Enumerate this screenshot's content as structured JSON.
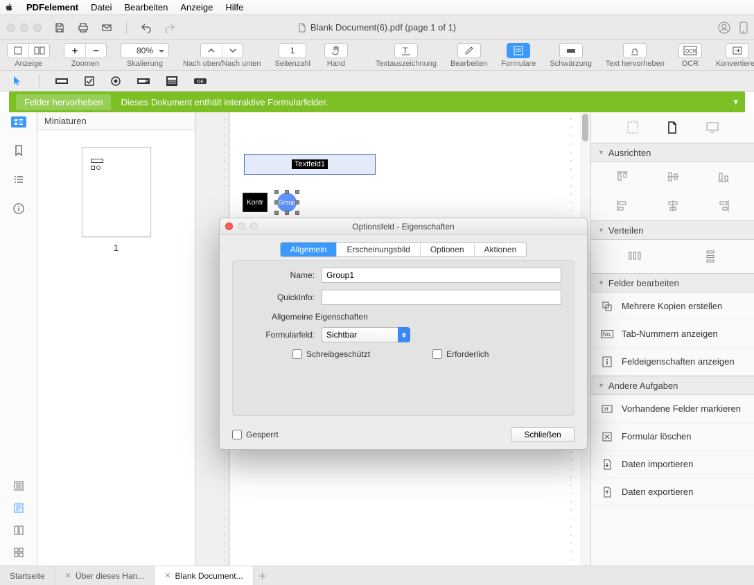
{
  "menubar": {
    "app": "PDFelement",
    "items": [
      "Datei",
      "Bearbeiten",
      "Anzeige",
      "Hilfe"
    ]
  },
  "titlebar": {
    "doc": "Blank Document(6).pdf (page 1 of 1)"
  },
  "toolbar": {
    "view_label": "Anzeige",
    "zoom_label": "Zoomen",
    "zoom_value": "80%",
    "scale_label": "Skalierung",
    "updown_label": "Nach oben/Nach unten",
    "page_value": "1",
    "page_label": "Seitenzahl",
    "hand_label": "Hand",
    "textmark_label": "Textauszeichnung",
    "edit_label": "Bearbeiten",
    "forms_label": "Formulare",
    "redact_label": "Schwärzung",
    "highlight_label": "Text hervorheben",
    "ocr_label": "OCR",
    "convert_label": "Konvertieren"
  },
  "greenbar": {
    "btn": "Felder hervorheben",
    "msg": "Dieses Dokument enthält interaktive Formularfelder."
  },
  "thumbs": {
    "header": "Miniaturen",
    "page1": "1"
  },
  "page_fields": {
    "textfield": "Textfeld1",
    "checkbox": "Kontr",
    "radio": "Group"
  },
  "rpanel": {
    "sec_align": "Ausrichten",
    "sec_distribute": "Verteilen",
    "sec_editfields": "Felder bearbeiten",
    "edit_items": [
      "Mehrere Kopien erstellen",
      "Tab-Nummern anzeigen",
      "Feldeigenschaften anzeigen"
    ],
    "sec_other": "Andere Aufgaben",
    "other_items": [
      "Vorhandene Felder markieren",
      "Formular löschen",
      "Daten importieren",
      "Daten exportieren"
    ]
  },
  "modal": {
    "title": "Optionsfeld - Eigenschaften",
    "tabs": [
      "Allgemein",
      "Erscheinungsbild",
      "Optionen",
      "Aktionen"
    ],
    "name_label": "Name:",
    "name_value": "Group1",
    "tooltip_label": "QuickInfo:",
    "tooltip_value": "",
    "subheader": "Allgemeine Eigenschaften",
    "formfield_label": "Formularfeld:",
    "formfield_value": "Sichtbar",
    "readonly_label": "Schreibgeschützt",
    "required_label": "Erforderlich",
    "locked_label": "Gesperrt",
    "close_btn": "Schließen"
  },
  "tabs": {
    "t1": "Startseite",
    "t2": "Über dieses Han...",
    "t3": "Blank Document..."
  }
}
